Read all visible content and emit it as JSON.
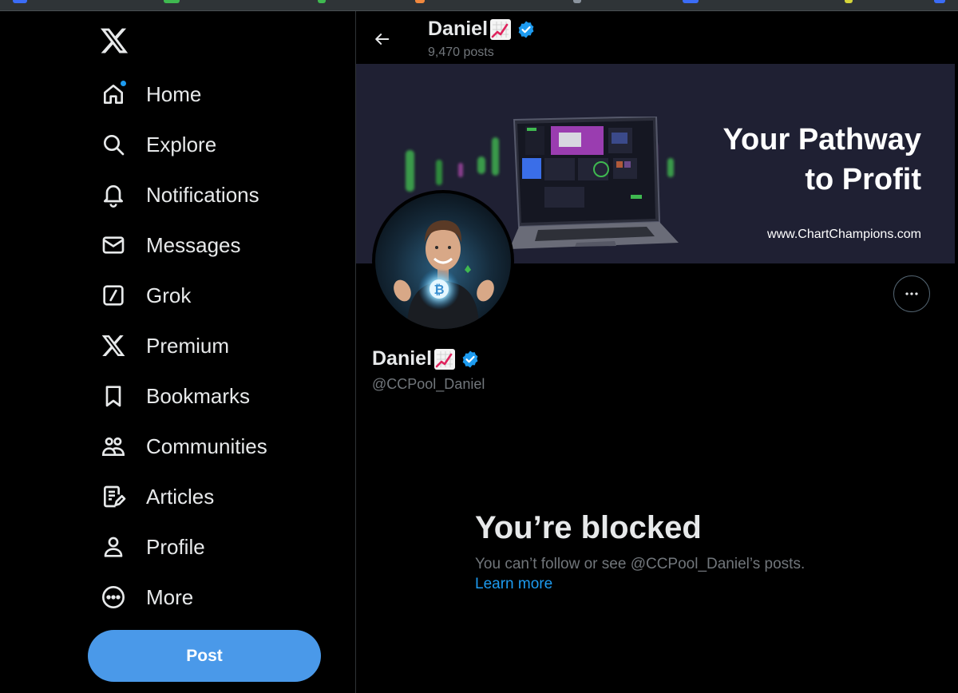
{
  "nav": {
    "items": [
      {
        "label": "Home",
        "icon": "home-icon"
      },
      {
        "label": "Explore",
        "icon": "search-icon"
      },
      {
        "label": "Notifications",
        "icon": "bell-icon"
      },
      {
        "label": "Messages",
        "icon": "envelope-icon"
      },
      {
        "label": "Grok",
        "icon": "grok-icon"
      },
      {
        "label": "Premium",
        "icon": "x-logo-icon"
      },
      {
        "label": "Bookmarks",
        "icon": "bookmark-icon"
      },
      {
        "label": "Communities",
        "icon": "people-icon"
      },
      {
        "label": "Articles",
        "icon": "article-icon"
      },
      {
        "label": "Profile",
        "icon": "person-icon"
      },
      {
        "label": "More",
        "icon": "more-circle-icon"
      }
    ],
    "post_label": "Post"
  },
  "header": {
    "name": "Daniel",
    "posts": "9,470 posts"
  },
  "banner": {
    "title": "Your Pathway\nto Profit",
    "url": "www.ChartChampions.com"
  },
  "profile": {
    "name": "Daniel",
    "handle": "@CCPool_Daniel"
  },
  "blocked": {
    "title": "You’re blocked",
    "description": "You can’t follow or see @CCPool_Daniel’s posts.",
    "link": "Learn more"
  },
  "colors": {
    "accent": "#1d9bf0",
    "post_button": "#4a99e9",
    "background": "#000000",
    "secondary_text": "#71767b"
  }
}
